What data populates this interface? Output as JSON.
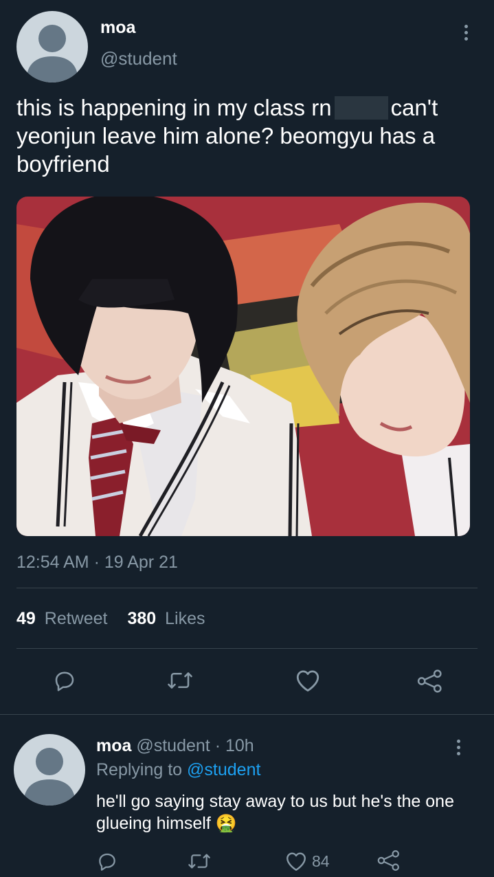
{
  "tweet": {
    "display_name": "moa",
    "handle": "@student",
    "text_part1": "this is happening in my class rn",
    "text_part2": "can't yeonjun leave him alone? beomgyu has a boyfriend",
    "timestamp": "12:54 AM · 19 Apr 21",
    "retweet_count": "49",
    "retweet_label": "Retweet",
    "like_count": "380",
    "like_label": "Likes"
  },
  "reply": {
    "display_name": "moa",
    "handle": "@student",
    "time": "· 10h",
    "replying_prefix": "Replying to",
    "replying_handle": "@student",
    "text": "he'll go saying stay away to us but he's the one glueing himself",
    "emoji": "🤮",
    "like_count": "84"
  },
  "icons": [
    "reply-icon",
    "retweet-icon",
    "like-icon",
    "share-icon",
    "more-icon"
  ],
  "colors": {
    "background": "#15202b",
    "muted": "#8899a6",
    "link": "#1da1f2",
    "divider": "#38444d"
  }
}
